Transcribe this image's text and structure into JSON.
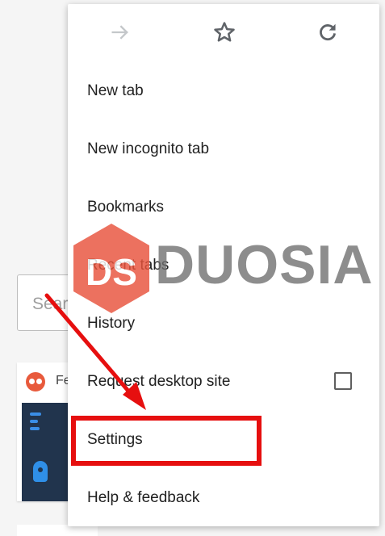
{
  "background": {
    "search_text": "Sear",
    "card_text": "Fe"
  },
  "toolbar": {
    "icons": [
      "forward-arrow-icon",
      "bookmark-star-icon",
      "reload-icon"
    ]
  },
  "menu": {
    "items": [
      {
        "label": "New tab"
      },
      {
        "label": "New incognito tab"
      },
      {
        "label": "Bookmarks"
      },
      {
        "label": "Recent tabs"
      },
      {
        "label": "History"
      },
      {
        "label": "Request desktop site",
        "checked": false
      },
      {
        "label": "Settings",
        "highlighted": true
      },
      {
        "label": "Help & feedback"
      }
    ]
  },
  "watermark": {
    "logo_letters": "DS",
    "word": "DUOSIA"
  },
  "colors": {
    "annotation": "#e60f0f",
    "watermark_hex": "#e8533c",
    "watermark_text": "#6e6e6e",
    "icon_gray": "#5f6368",
    "icon_disabled": "#c4c7ca"
  }
}
